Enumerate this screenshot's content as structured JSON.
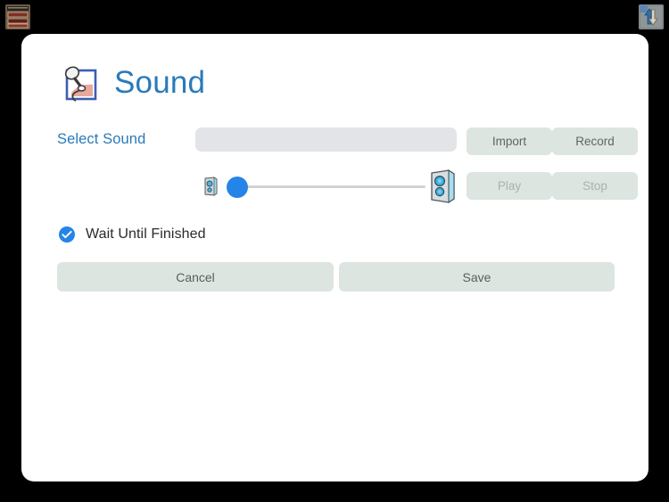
{
  "window": {
    "background_color": "#000000",
    "card_background": "#ffffff",
    "top_left_icon": "window-stack-icon",
    "top_right_icon": "up-down-arrows-icon"
  },
  "header": {
    "icon": "microphone-sound-icon",
    "title": "Sound",
    "title_color": "#2a7ab9"
  },
  "select_sound": {
    "label": "Select Sound",
    "label_color": "#2a7ab9",
    "input_value": "",
    "input_placeholder": "",
    "input_background": "#e3e4e8"
  },
  "buttons": {
    "import": {
      "label": "Import",
      "enabled": true
    },
    "record": {
      "label": "Record",
      "enabled": true
    },
    "play": {
      "label": "Play",
      "enabled": false
    },
    "stop": {
      "label": "Stop",
      "enabled": false
    },
    "cancel": {
      "label": "Cancel"
    },
    "save": {
      "label": "Save"
    },
    "fill_color": "#dde5e0",
    "text_color": "#5e6663",
    "disabled_text_color": "#a9b2ae"
  },
  "volume_slider": {
    "low_icon": "speaker-low-icon",
    "high_icon": "speaker-high-icon",
    "value_percent": 2,
    "min": 0,
    "max": 100,
    "thumb_color": "#2584e8",
    "track_color": "#d2d2d4"
  },
  "wait_until_finished": {
    "label": "Wait Until Finished",
    "checked": true,
    "checkbox_color": "#2584e8"
  }
}
